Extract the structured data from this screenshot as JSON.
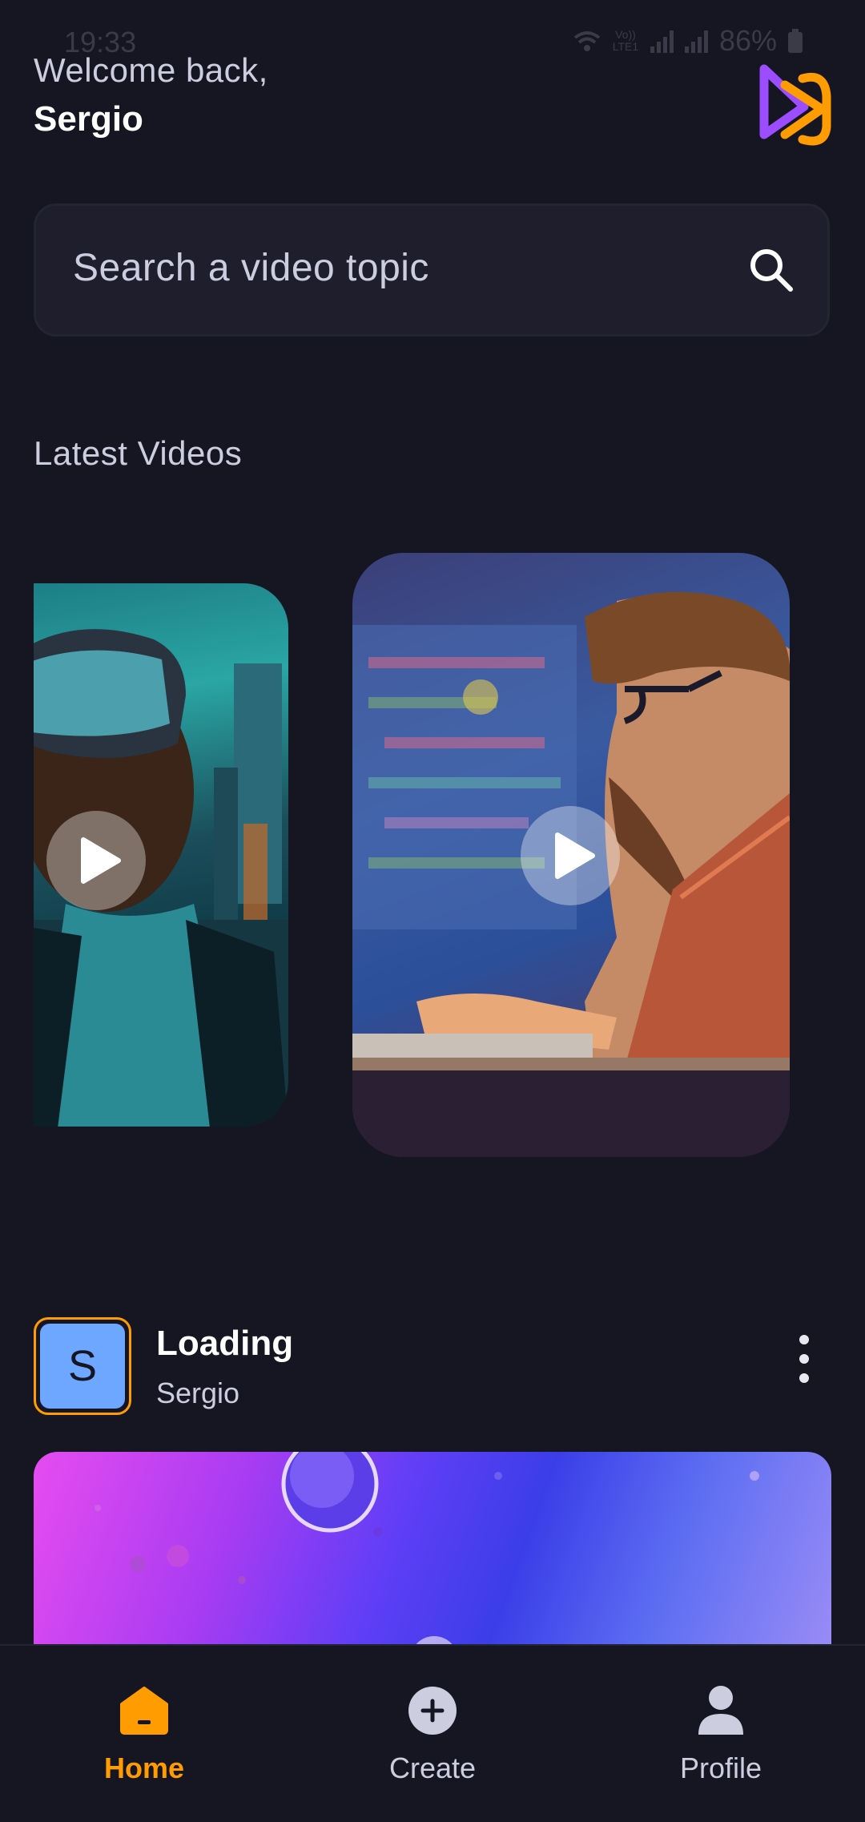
{
  "status_bar": {
    "time": "19:33",
    "battery": "86%",
    "network": "Vo)) LTE1"
  },
  "header": {
    "welcome": "Welcome back,",
    "username": "Sergio"
  },
  "search": {
    "placeholder": "Search a video topic"
  },
  "latest": {
    "title": "Latest Videos"
  },
  "post": {
    "avatar_letter": "S",
    "title": "Loading",
    "author": "Sergio"
  },
  "tabs": [
    {
      "label": "Home",
      "icon": "home-icon",
      "active": true
    },
    {
      "label": "Create",
      "icon": "plus-circle-icon",
      "active": false
    },
    {
      "label": "Profile",
      "icon": "profile-icon",
      "active": false
    }
  ],
  "colors": {
    "accent": "#ff9c01",
    "background": "#161622",
    "input_bg": "#1e1e2d",
    "logo_purple": "#9b4dff"
  }
}
